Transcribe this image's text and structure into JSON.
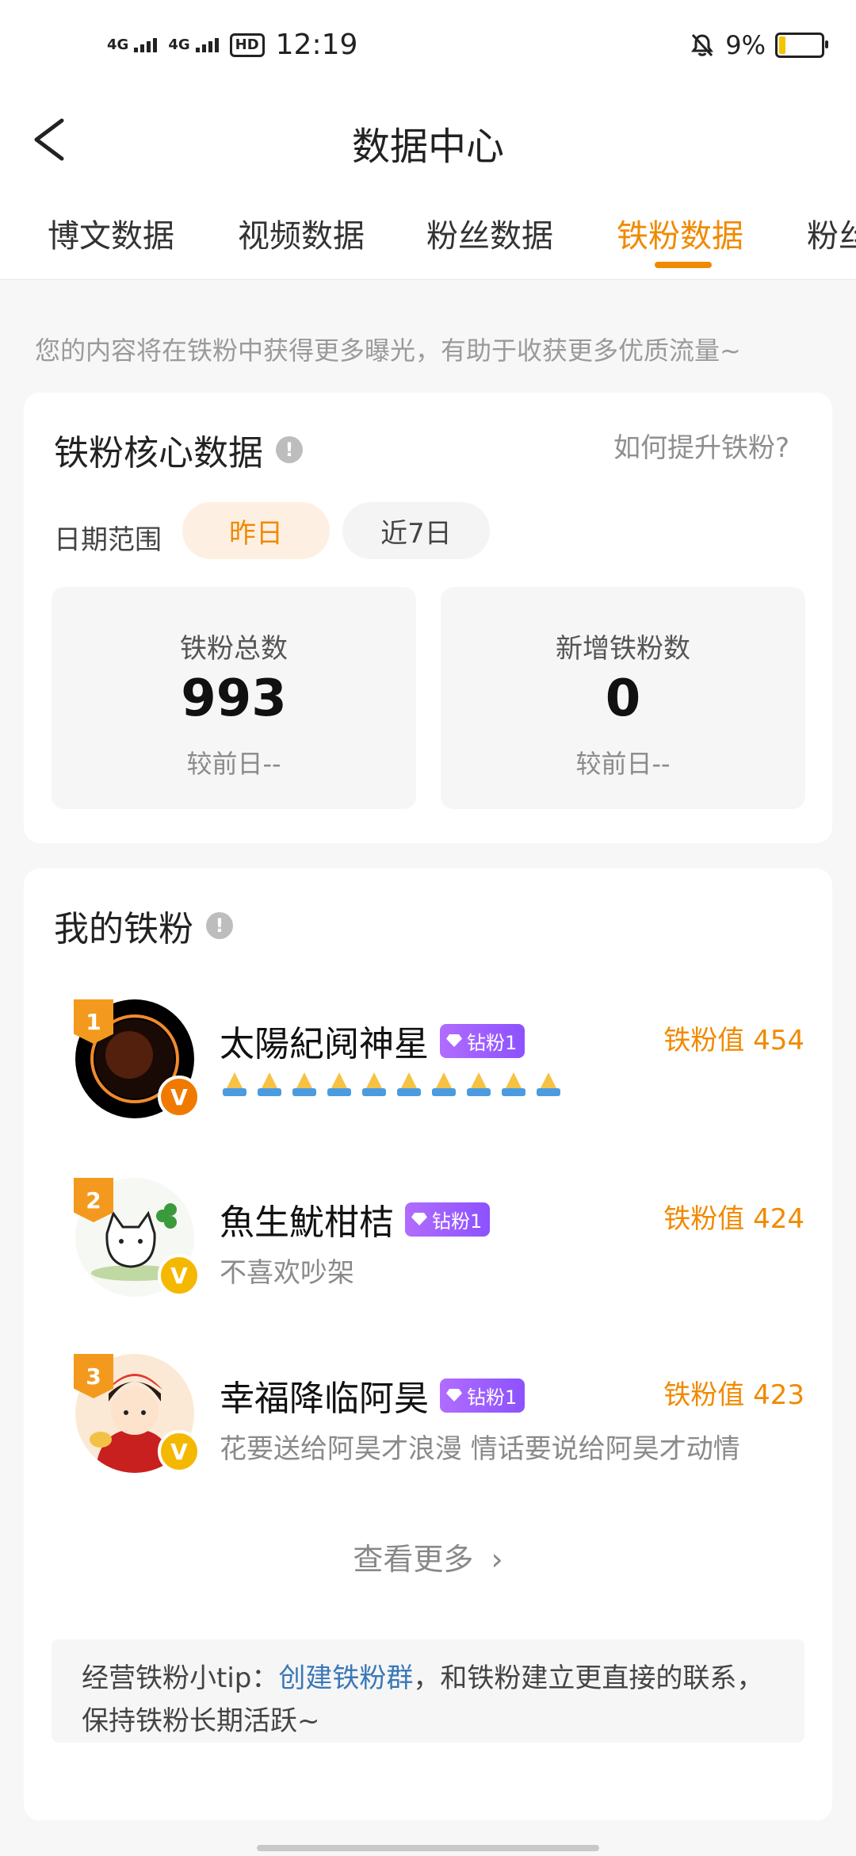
{
  "status_bar": {
    "signal_1": "4G",
    "signal_2": "4G",
    "hd_label": "HD",
    "time": "12:19",
    "battery_percent": "9%",
    "battery_level": 0.09
  },
  "header": {
    "title": "数据中心"
  },
  "tabs": [
    {
      "label": "博文数据",
      "active": false
    },
    {
      "label": "视频数据",
      "active": false
    },
    {
      "label": "粉丝数据",
      "active": false
    },
    {
      "label": "铁粉数据",
      "active": true
    },
    {
      "label": "粉丝",
      "active": false
    }
  ],
  "hint": "您的内容将在铁粉中获得更多曝光，有助于收获更多优质流量~",
  "core": {
    "title": "铁粉核心数据",
    "info_icon": "!",
    "how_link": "如何提升铁粉?",
    "date_range_label": "日期范围",
    "date_options": [
      "昨日",
      "近7日"
    ],
    "selected_date": "昨日",
    "stats": [
      {
        "label": "铁粉总数",
        "value": "993",
        "compare": "较前日--"
      },
      {
        "label": "新增铁粉数",
        "value": "0",
        "compare": "较前日--"
      }
    ]
  },
  "my_fans": {
    "title": "我的铁粉",
    "info_icon": "!",
    "fans": [
      {
        "rank": "1",
        "name": "太陽紀阋神星",
        "level": "钻粉1",
        "value": "铁粉值 454",
        "signature": "",
        "signature_icons": "prayer-emoji x10",
        "verified": "V"
      },
      {
        "rank": "2",
        "name": "魚生魷柑桔",
        "level": "钻粉1",
        "value": "铁粉值 424",
        "signature": "不喜欢吵架",
        "verified": "V"
      },
      {
        "rank": "3",
        "name": "幸福降临阿昊",
        "level": "钻粉1",
        "value": "铁粉值 423",
        "signature": "花要送给阿昊才浪漫 情话要说给阿昊才动情",
        "verified": "V"
      }
    ],
    "more": "查看更多",
    "more_chevron": "›",
    "tip_prefix": "经营铁粉小tip：",
    "tip_link": "创建铁粉群",
    "tip_suffix": "，和铁粉建立更直接的联系，保持铁粉长期活跃~"
  },
  "colors": {
    "accent": "#f08a00",
    "link": "#3a78b8",
    "level_badge": "#9b5cff"
  }
}
